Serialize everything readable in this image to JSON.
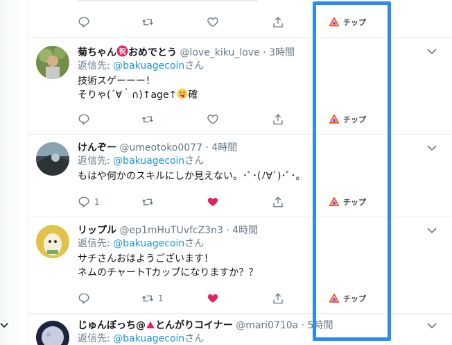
{
  "colors": {
    "accent": "#1b95e0",
    "like": "#e0245e",
    "highlight": "#2d8cf0",
    "muted": "#657786"
  },
  "tip_label": "チップ",
  "tweets": [
    {
      "name_pre": "菊ちゃん",
      "name_post": "おめでとう",
      "handle": "@love_kiku_love",
      "time": "3時間",
      "reply_label": "返信先: ",
      "reply_to": "@bakuagecoin",
      "reply_suffix": "さん",
      "line1": "技術スゲーーー！",
      "line2": "そりゃ(´∀｀∩)↑age↑",
      "line2_after": "確",
      "replies": "",
      "retweets": "",
      "likes": "",
      "liked": false
    },
    {
      "name": "けんぞー",
      "handle": "@umeotoko0077",
      "time": "4時間",
      "reply_label": "返信先: ",
      "reply_to": "@bakuagecoin",
      "reply_suffix": "さん",
      "text": "もはや何かのスキルにしか見えない。･ﾟ･(ﾉ∀`)･ﾟ･。",
      "replies": "1",
      "retweets": "",
      "likes": "",
      "liked": true
    },
    {
      "name": "リップル",
      "handle": "@ep1mHuTUvfcZ3n3",
      "time": "4時間",
      "reply_label": "返信先: ",
      "reply_to": "@bakuagecoin",
      "reply_suffix": "さん",
      "text": "サチさんおはようございます！\nネムのチャートTカップになりますか？？",
      "replies": "",
      "retweets": "1",
      "likes": "",
      "liked": true
    },
    {
      "name_pre": "じゅんぼっち@",
      "name_post": "とんがりコイナー",
      "handle": "@mari0710a",
      "time": "5時間",
      "reply_label": "返信先: ",
      "reply_to": "@bakuagecoin",
      "reply_suffix": "さん"
    }
  ]
}
